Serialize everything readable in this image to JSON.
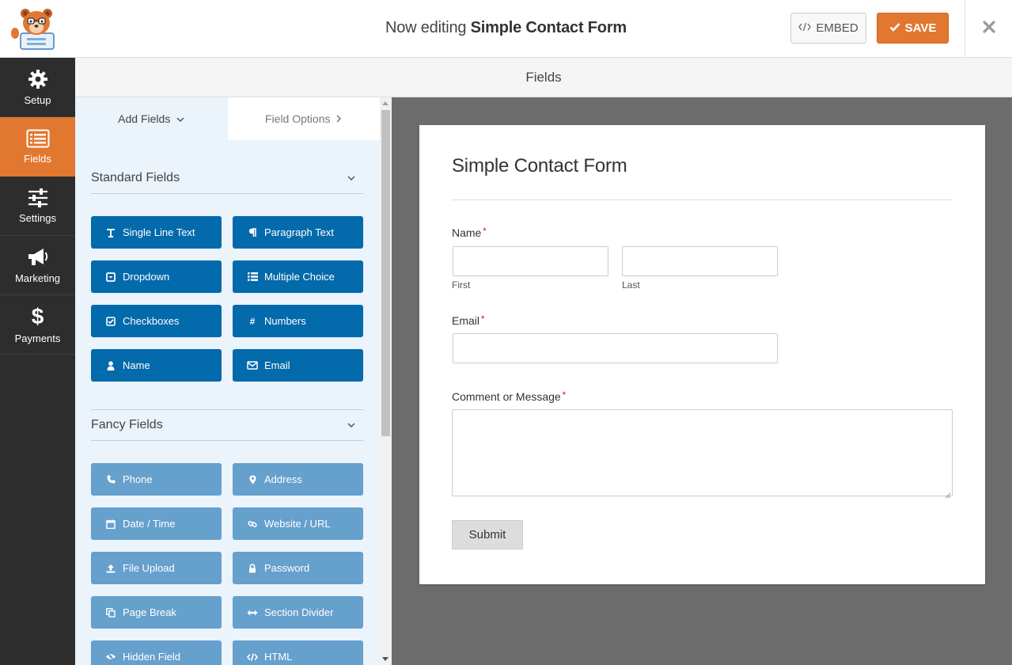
{
  "header": {
    "title_prefix": "Now editing",
    "form_name": "Simple Contact Form",
    "embed_label": "EMBED",
    "save_label": "SAVE"
  },
  "nav": {
    "items": [
      {
        "label": "Setup",
        "icon": "gear-icon",
        "active": false
      },
      {
        "label": "Fields",
        "icon": "list-icon",
        "active": true
      },
      {
        "label": "Settings",
        "icon": "sliders-icon",
        "active": false
      },
      {
        "label": "Marketing",
        "icon": "megaphone-icon",
        "active": false
      },
      {
        "label": "Payments",
        "icon": "dollar-icon",
        "active": false
      }
    ]
  },
  "subheader": {
    "title": "Fields"
  },
  "panel": {
    "tabs": [
      {
        "label": "Add Fields",
        "icon": "chevron-down-icon"
      },
      {
        "label": "Field Options",
        "icon": "chevron-right-icon"
      }
    ],
    "sections": [
      {
        "title": "Standard Fields",
        "buttons": [
          {
            "label": "Single Line Text",
            "icon": "text-icon"
          },
          {
            "label": "Paragraph Text",
            "icon": "paragraph-icon"
          },
          {
            "label": "Dropdown",
            "icon": "dropdown-icon"
          },
          {
            "label": "Multiple Choice",
            "icon": "list-icon"
          },
          {
            "label": "Checkboxes",
            "icon": "checkbox-icon"
          },
          {
            "label": "Numbers",
            "icon": "hash-icon"
          },
          {
            "label": "Name",
            "icon": "user-icon"
          },
          {
            "label": "Email",
            "icon": "envelope-icon"
          }
        ]
      },
      {
        "title": "Fancy Fields",
        "buttons": [
          {
            "label": "Phone",
            "icon": "phone-icon"
          },
          {
            "label": "Address",
            "icon": "map-marker-icon"
          },
          {
            "label": "Date / Time",
            "icon": "calendar-icon"
          },
          {
            "label": "Website / URL",
            "icon": "link-icon"
          },
          {
            "label": "File Upload",
            "icon": "upload-icon"
          },
          {
            "label": "Password",
            "icon": "lock-icon"
          },
          {
            "label": "Page Break",
            "icon": "copy-icon"
          },
          {
            "label": "Section Divider",
            "icon": "arrows-h-icon"
          },
          {
            "label": "Hidden Field",
            "icon": "eye-slash-icon"
          },
          {
            "label": "HTML",
            "icon": "code-icon"
          }
        ]
      }
    ]
  },
  "form": {
    "title": "Simple Contact Form",
    "name_label": "Name",
    "first_sublabel": "First",
    "last_sublabel": "Last",
    "email_label": "Email",
    "comment_label": "Comment or Message",
    "required_mark": "*",
    "submit_label": "Submit"
  },
  "colors": {
    "accent": "#e27730",
    "standard_button": "#036aab",
    "fancy_button": "#66a0cd",
    "nav_bg": "#2d2d2d",
    "preview_bg": "#6c6c6c"
  }
}
